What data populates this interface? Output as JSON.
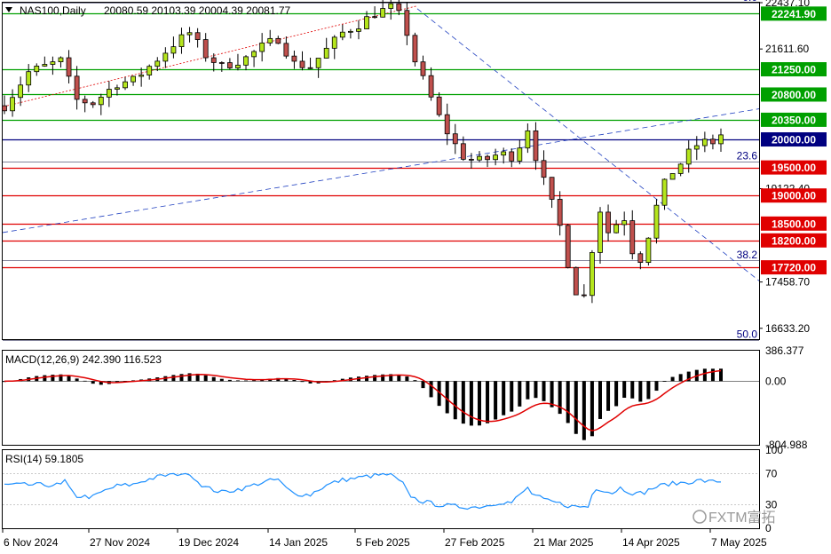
{
  "header": {
    "symbol_label": "NAS100,Daily",
    "ohlc_text": "20080.59 20103.39 20004.39 20081.77"
  },
  "colors": {
    "bull": "#b5e61d",
    "bear": "#c0504d",
    "hline_red": "#e00000",
    "hline_green": "#00a000",
    "hline_navy": "#000080",
    "trend_red": "#e00000",
    "trend_blue": "#2040c0",
    "macd_signal": "#e00000",
    "rsi_line": "#1e90ff"
  },
  "price_axis": {
    "ticks": [
      "22437.10",
      "21611.60",
      "19122.40",
      "17458.70",
      "16633.20"
    ]
  },
  "level_labels": [
    {
      "text": "22241.90",
      "value": 22241.9,
      "kind": "green"
    },
    {
      "text": "21250.00",
      "value": 21250,
      "kind": "green"
    },
    {
      "text": "20800.00",
      "value": 20800,
      "kind": "green"
    },
    {
      "text": "20350.00",
      "value": 20350,
      "kind": "green"
    },
    {
      "text": "20000.00",
      "value": 20000,
      "kind": "navy"
    },
    {
      "text": "19500.00",
      "value": 19500,
      "kind": "red"
    },
    {
      "text": "19000.00",
      "value": 19000,
      "kind": "red"
    },
    {
      "text": "18500.00",
      "value": 18500,
      "kind": "red"
    },
    {
      "text": "18200.00",
      "value": 18200,
      "kind": "red"
    },
    {
      "text": "17720.00",
      "value": 17720,
      "kind": "red"
    }
  ],
  "fib_labels": [
    {
      "text": "0.0",
      "value": 22437
    },
    {
      "text": "23.6",
      "value": 19610
    },
    {
      "text": "38.2",
      "value": 17845
    },
    {
      "text": "50.0",
      "value": 16430
    }
  ],
  "macd": {
    "label": "MACD(12,26,9) 242.390 116.523",
    "ticks": [
      "386.377",
      "0.00",
      "-804.988"
    ]
  },
  "rsi": {
    "label": "RSI(14) 59.1805",
    "ticks": [
      "100",
      "70",
      "30",
      "0"
    ]
  },
  "x_axis": {
    "labels": [
      "6 Nov 2024",
      "27 Nov 2024",
      "19 Dec 2024",
      "14 Jan 2025",
      "5 Feb 2025",
      "27 Feb 2025",
      "21 Mar 2025",
      "14 Apr 2025",
      "7 May 2025"
    ]
  },
  "watermark": "FXTM富拓",
  "chart_data": {
    "type": "candlestick",
    "symbol": "NAS100",
    "timeframe": "Daily",
    "last_ohlc": {
      "open": 20080.59,
      "high": 20103.39,
      "low": 20004.39,
      "close": 20081.77
    },
    "ylim": [
      16440,
      22437.1
    ],
    "anchors": [
      [
        22300,
        21050,
        20600,
        21300
      ],
      [
        21300,
        20850,
        20600,
        21550
      ],
      [
        21550,
        21450,
        21250,
        21600
      ],
      [
        21400,
        21300,
        21000,
        21850
      ],
      [
        21850,
        22050,
        21550,
        22000
      ],
      [
        22000,
        21900,
        21650,
        22200
      ],
      [
        22200,
        21650,
        21350,
        22050
      ],
      [
        21650,
        21200,
        21000,
        21400
      ],
      [
        21200,
        20700,
        20200,
        20600
      ],
      [
        20700,
        19550,
        19050,
        19950
      ],
      [
        19550,
        19800,
        19350,
        19300
      ],
      [
        19800,
        20350,
        20100,
        19700
      ],
      [
        20350,
        19600,
        18900,
        19000
      ],
      [
        18950,
        18250,
        17300,
        17800
      ],
      [
        17300,
        19000,
        16800,
        18000
      ],
      [
        18300,
        18700,
        17900,
        17500
      ],
      [
        18700,
        19400,
        19600,
        19850
      ],
      [
        19400,
        19750,
        20000,
        20081.77
      ]
    ],
    "levels": [
      22241.9,
      21250,
      20800,
      20350,
      20000,
      19500,
      19000,
      18500,
      18200,
      17720
    ],
    "fibonacci": [
      {
        "level": "0.0",
        "price": 22437
      },
      {
        "level": "23.6",
        "price": 19610
      },
      {
        "level": "38.2",
        "price": 17845
      },
      {
        "level": "50.0",
        "price": 16430
      }
    ],
    "macd": {
      "params": [
        12,
        26,
        9
      ],
      "main": 242.39,
      "signal": 116.523,
      "range": [
        -804.988,
        386.377
      ]
    },
    "rsi": {
      "period": 14,
      "value": 59.1805,
      "levels": [
        70,
        30
      ]
    }
  }
}
